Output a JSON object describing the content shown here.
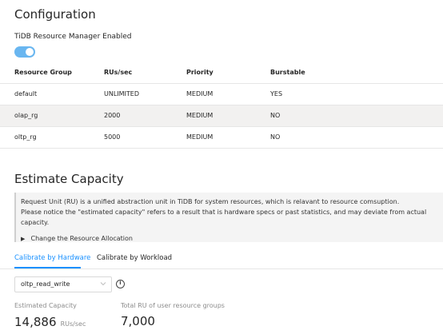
{
  "configuration": {
    "title": "Configuration",
    "toggle_label": "TiDB Resource Manager Enabled",
    "toggle_on": true,
    "table": {
      "columns": [
        "Resource Group",
        "RUs/sec",
        "Priority",
        "Burstable"
      ],
      "rows": [
        [
          "default",
          "UNLIMITED",
          "MEDIUM",
          "YES"
        ],
        [
          "olap_rg",
          "2000",
          "MEDIUM",
          "NO"
        ],
        [
          "oltp_rg",
          "5000",
          "MEDIUM",
          "NO"
        ]
      ]
    }
  },
  "estimate": {
    "title": "Estimate Capacity",
    "info_line1": "Request Unit (RU) is a unified abstraction unit in TiDB for system resources, which is relavant to resource comsuption.",
    "info_line2": "Please notice the \"estimated capacity\" refers to a result that is hardware specs or past statistics, and may deviate from actual capacity.",
    "collapse_label": "Change the Resource Allocation",
    "tabs": [
      "Calibrate by Hardware",
      "Calibrate by Workload"
    ],
    "active_tab": 0,
    "workload_select": "oltp_read_write",
    "estimated_capacity_label": "Estimated Capacity",
    "estimated_capacity_value": "14,886",
    "estimated_capacity_unit": "RUs/sec",
    "total_ru_label": "Total RU of user resource groups",
    "total_ru_value": "7,000"
  },
  "colors": {
    "accent": "#1890ff",
    "toggle": "#69b6f0",
    "row_shade": "#f2f1f0"
  }
}
